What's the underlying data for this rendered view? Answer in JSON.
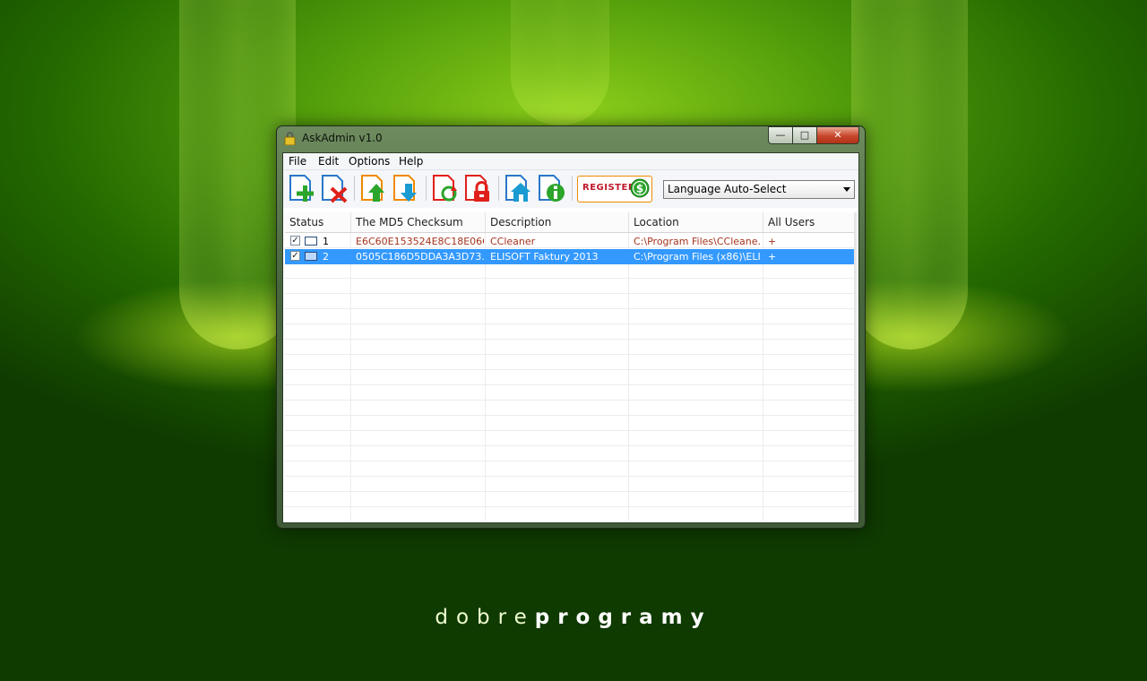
{
  "window": {
    "title": "AskAdmin v1.0",
    "minimize_glyph": "—",
    "maximize_glyph": "□",
    "close_glyph": "✕"
  },
  "menu": [
    "File",
    "Edit",
    "Options",
    "Help"
  ],
  "toolbar": {
    "buttons": [
      {
        "icon": "add-file-icon"
      },
      {
        "icon": "remove-file-icon"
      },
      {
        "icon": "import-icon"
      },
      {
        "icon": "export-icon"
      },
      {
        "icon": "refresh-icon"
      },
      {
        "icon": "lock-icon"
      },
      {
        "icon": "home-icon"
      },
      {
        "icon": "info-icon"
      }
    ],
    "register_label": "REGISTER",
    "language_select": "Language Auto-Select"
  },
  "table": {
    "columns": [
      "Status",
      "The MD5 Checksum",
      "Description",
      "Location",
      "All Users"
    ],
    "rows": [
      {
        "checked": true,
        "num": "1",
        "md5": "E6C60E153524E8C18E06C...",
        "description": "CCleaner",
        "location": "C:\\Program Files\\CCleane...",
        "all_users": "+",
        "selected": false
      },
      {
        "checked": true,
        "num": "2",
        "md5": "0505C186D5DDA3A3D73...",
        "description": "ELISOFT Faktury 2013",
        "location": "C:\\Program Files (x86)\\ELI...",
        "all_users": "+",
        "selected": true
      }
    ]
  },
  "branding": {
    "light": "dobre",
    "bold": "programy"
  },
  "colors": {
    "accent": "#3399ff",
    "register_border": "#f08a00",
    "close": "#c7452a"
  }
}
